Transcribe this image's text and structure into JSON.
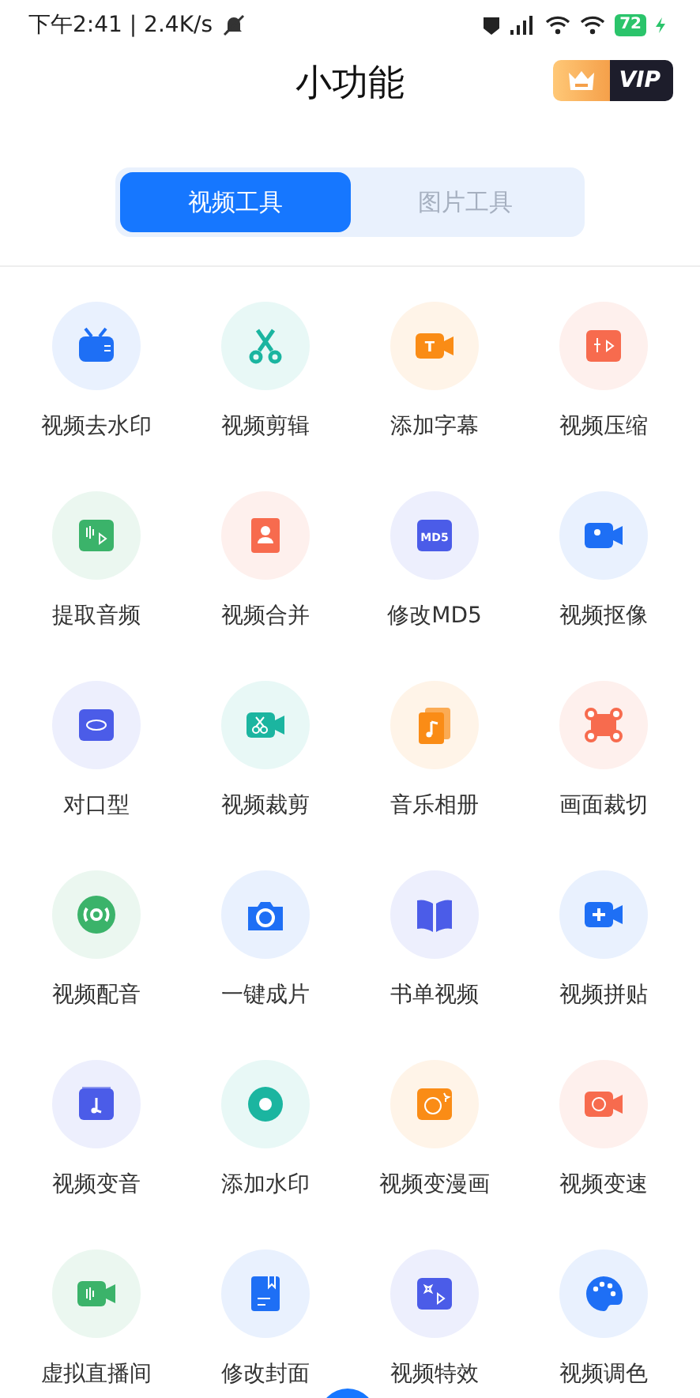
{
  "status_bar": {
    "time_speed": "下午2:41 | 2.4K/s",
    "battery": "72"
  },
  "header": {
    "title": "小功能",
    "vip_label": "VIP"
  },
  "tabs": [
    {
      "label": "视频工具",
      "selected": true
    },
    {
      "label": "图片工具",
      "selected": false
    }
  ],
  "tools": [
    {
      "label": "视频去水印",
      "color": "#1e6ff5"
    },
    {
      "label": "视频剪辑",
      "color": "#1bb5a0"
    },
    {
      "label": "添加字幕",
      "color": "#fa8c16",
      "icon_text": "T"
    },
    {
      "label": "视频压缩",
      "color": "#f76b4e"
    },
    {
      "label": "提取音频",
      "color": "#3bb36a"
    },
    {
      "label": "视频合并",
      "color": "#f76b4e"
    },
    {
      "label": "修改MD5",
      "color": "#4b5ce8",
      "icon_text": "MD5"
    },
    {
      "label": "视频抠像",
      "color": "#1e6ff5"
    },
    {
      "label": "对口型",
      "color": "#4b5ce8"
    },
    {
      "label": "视频裁剪",
      "color": "#1bb5a0"
    },
    {
      "label": "音乐相册",
      "color": "#fa8c16"
    },
    {
      "label": "画面裁切",
      "color": "#f76b4e"
    },
    {
      "label": "视频配音",
      "color": "#3bb36a"
    },
    {
      "label": "一键成片",
      "color": "#1e6ff5"
    },
    {
      "label": "书单视频",
      "color": "#4b5ce8"
    },
    {
      "label": "视频拼贴",
      "color": "#1e6ff5"
    },
    {
      "label": "视频变音",
      "color": "#4b5ce8"
    },
    {
      "label": "添加水印",
      "color": "#1bb5a0"
    },
    {
      "label": "视频变漫画",
      "color": "#fa8c16"
    },
    {
      "label": "视频变速",
      "color": "#f76b4e"
    },
    {
      "label": "虚拟直播间",
      "color": "#3bb36a"
    },
    {
      "label": "修改封面",
      "color": "#1e6ff5"
    },
    {
      "label": "视频特效",
      "color": "#4b5ce8"
    },
    {
      "label": "视频调色",
      "color": "#1e6ff5"
    }
  ]
}
